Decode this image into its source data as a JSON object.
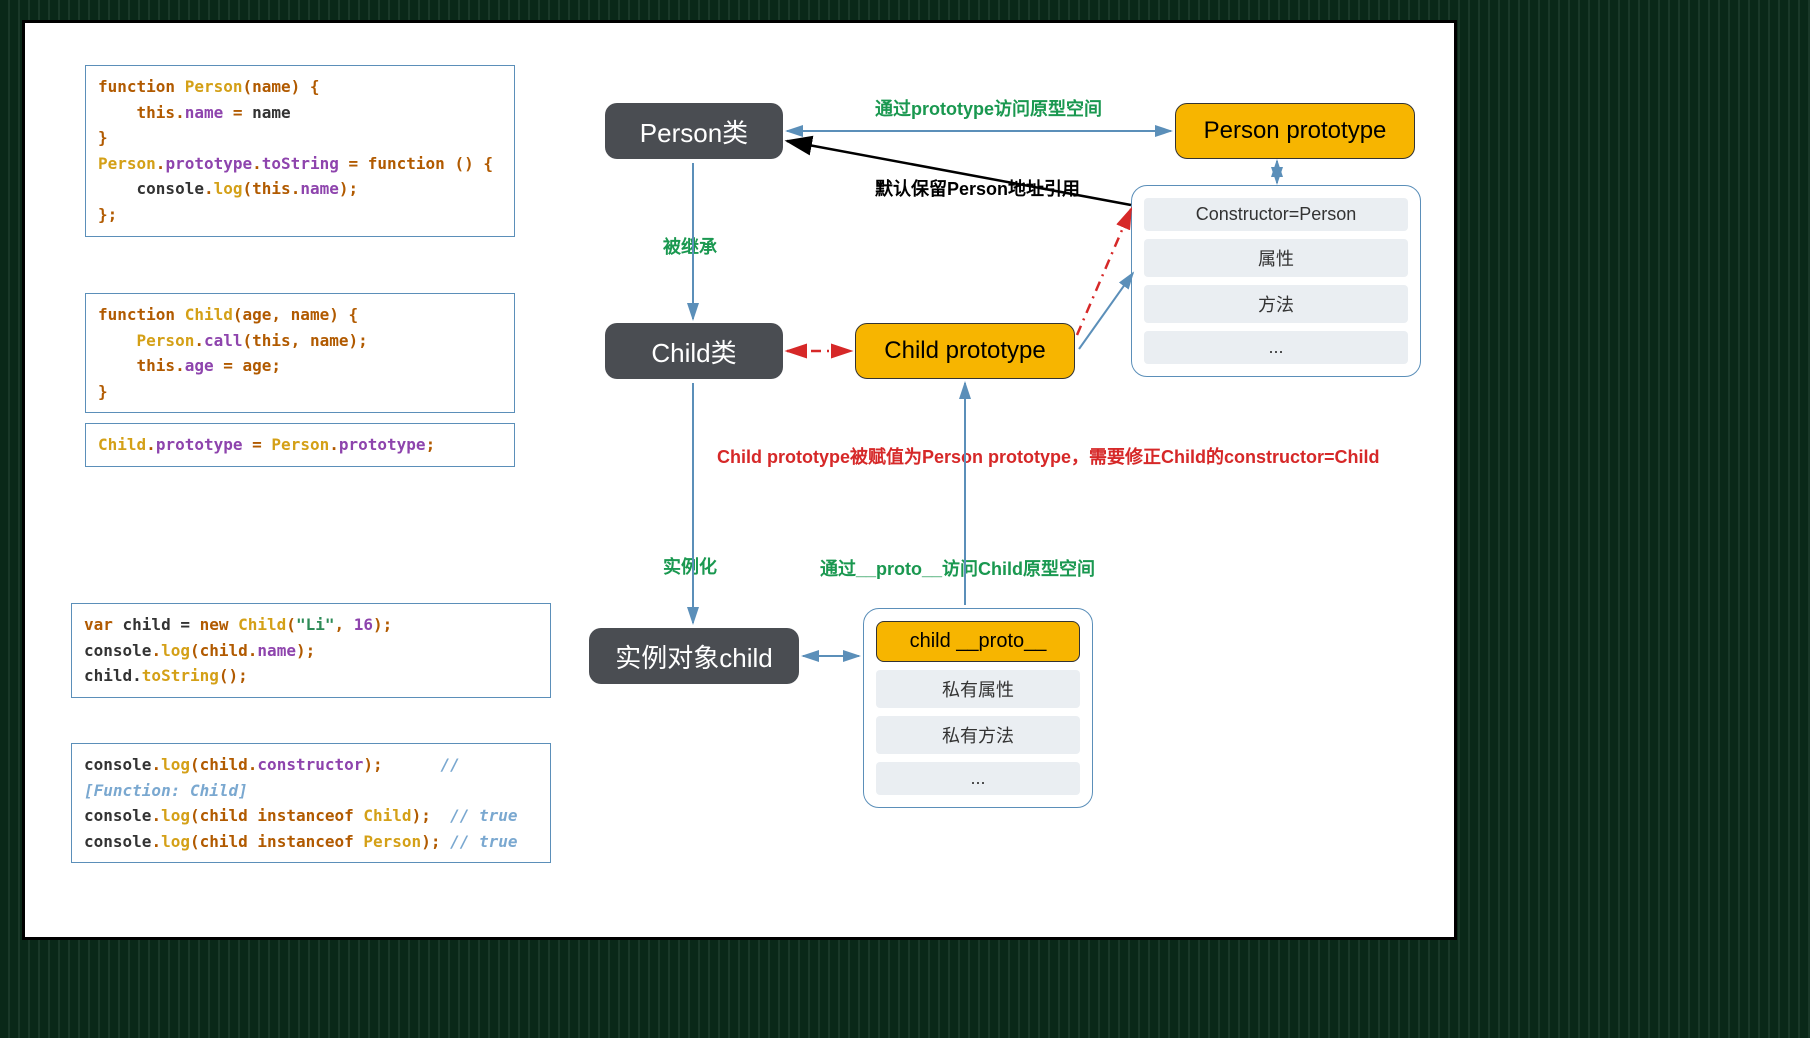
{
  "code1": {
    "l1_kw": "function ",
    "l1_fn": "Person",
    "l1_sig": "(name) {",
    "l2_this": "this",
    "l2_dot": ".",
    "l2_prop": "name",
    "l2_eq": " = ",
    "l2_val": "name",
    "l3": "}",
    "l4_a": "Person",
    "l4_b": ".",
    "l4_c": "prototype",
    "l4_d": ".",
    "l4_e": "toString",
    "l4_f": " = ",
    "l4_g": "function ",
    "l4_h": "() {",
    "l5_a": "console",
    "l5_b": ".",
    "l5_c": "log",
    "l5_d": "(",
    "l5_e": "this",
    "l5_f": ".",
    "l5_g": "name",
    "l5_h": ");",
    "l6": "};"
  },
  "code2": {
    "l1_kw": "function ",
    "l1_fn": "Child",
    "l1_sig": "(age, name) {",
    "l2_a": "Person",
    "l2_b": ".",
    "l2_c": "call",
    "l2_d": "(",
    "l2_e": "this",
    "l2_f": ", name);",
    "l3_a": "this",
    "l3_b": ".",
    "l3_c": "age",
    "l3_d": " = age;",
    "l4": "}"
  },
  "code3": {
    "a": "Child",
    "b": ".",
    "c": "prototype",
    "d": " = ",
    "e": "Person",
    "f": ".",
    "g": "prototype",
    "h": ";"
  },
  "code4": {
    "l1_a": "var ",
    "l1_b": "child = ",
    "l1_c": "new ",
    "l1_d": "Child",
    "l1_e": "(",
    "l1_f": "\"Li\"",
    "l1_g": ", ",
    "l1_h": "16",
    "l1_i": ");",
    "l2_a": "console",
    "l2_b": ".",
    "l2_c": "log",
    "l2_d": "(child.",
    "l2_e": "name",
    "l2_f": ");",
    "l3_a": "child.",
    "l3_b": "toString",
    "l3_c": "();"
  },
  "code5": {
    "l1_a": "console",
    "l1_b": ".",
    "l1_c": "log",
    "l1_d": "(child.",
    "l1_e": "constructor",
    "l1_f": ");",
    "l1_pad": "      ",
    "l1_cmt": "// [Function: Child]",
    "l2_a": "console",
    "l2_b": ".",
    "l2_c": "log",
    "l2_d": "(child ",
    "l2_e": "instanceof ",
    "l2_f": "Child",
    "l2_g": ");  ",
    "l2_cmt": "// true",
    "l3_a": "console",
    "l3_b": ".",
    "l3_c": "log",
    "l3_d": "(child ",
    "l3_e": "instanceof ",
    "l3_f": "Person",
    "l3_g": "); ",
    "l3_cmt": "// true"
  },
  "nodes": {
    "person": "Person类",
    "child": "Child类",
    "instance": "实例对象child",
    "person_proto": "Person prototype",
    "child_proto": "Child prototype"
  },
  "panels": {
    "person_proto": {
      "head": "Constructor=Person",
      "r1": "属性",
      "r2": "方法",
      "r3": "..."
    },
    "instance": {
      "head": "child __proto__",
      "r1": "私有属性",
      "r2": "私有方法",
      "r3": "..."
    }
  },
  "labels": {
    "l1": "通过prototype访问原型空间",
    "l2": "默认保留Person地址引用",
    "l3": "被继承",
    "l4": "Child prototype被赋值为Person prototype，需要修正Child的constructor=Child",
    "l5": "实例化",
    "l6": "通过__proto__访问Child原型空间"
  }
}
